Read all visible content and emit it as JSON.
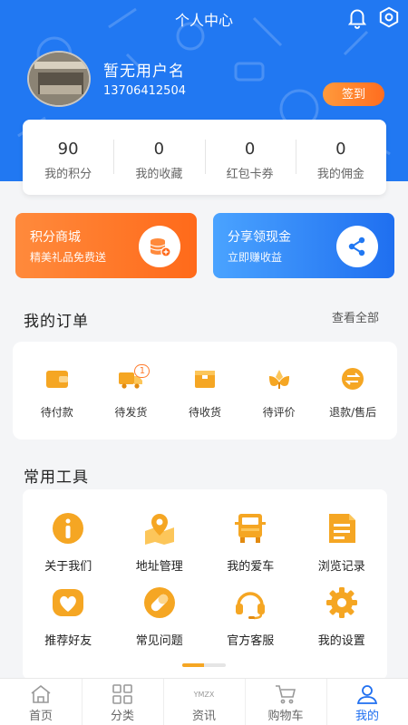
{
  "header": {
    "title": "个人中心"
  },
  "profile": {
    "username": "暂无用户名",
    "phone": "13706412504",
    "signin_label": "签到"
  },
  "stats": [
    {
      "value": "90",
      "label": "我的积分"
    },
    {
      "value": "0",
      "label": "我的收藏"
    },
    {
      "value": "0",
      "label": "红包卡券"
    },
    {
      "value": "0",
      "label": "我的佣金"
    }
  ],
  "promos": [
    {
      "title": "积分商城",
      "subtitle": "精美礼品免费送"
    },
    {
      "title": "分享领现金",
      "subtitle": "立即赚收益"
    }
  ],
  "orders": {
    "title": "我的订单",
    "view_all": "查看全部",
    "items": [
      {
        "label": "待付款"
      },
      {
        "label": "待发货",
        "badge": "1"
      },
      {
        "label": "待收货"
      },
      {
        "label": "待评价"
      },
      {
        "label": "退款/售后"
      }
    ]
  },
  "tools": {
    "title": "常用工具",
    "items": [
      {
        "label": "关于我们",
        "icon": "info-icon"
      },
      {
        "label": "地址管理",
        "icon": "map-pin-icon"
      },
      {
        "label": "我的爱车",
        "icon": "truck-icon"
      },
      {
        "label": "浏览记录",
        "icon": "document-icon"
      },
      {
        "label": "推荐好友",
        "icon": "heart-icon"
      },
      {
        "label": "常见问题",
        "icon": "pill-icon"
      },
      {
        "label": "官方客服",
        "icon": "headset-icon"
      },
      {
        "label": "我的设置",
        "icon": "gear-icon"
      }
    ],
    "scroll_fraction": 0.5
  },
  "tabbar": {
    "items": [
      {
        "label": "首页"
      },
      {
        "label": "分类"
      },
      {
        "label": "资讯",
        "logo_text": "YMZX"
      },
      {
        "label": "购物车"
      },
      {
        "label": "我的",
        "active": true
      }
    ]
  },
  "colors": {
    "primary": "#2178f2",
    "accent_orange": "#ff7a2b",
    "icon_yellow": "#f5a623"
  }
}
